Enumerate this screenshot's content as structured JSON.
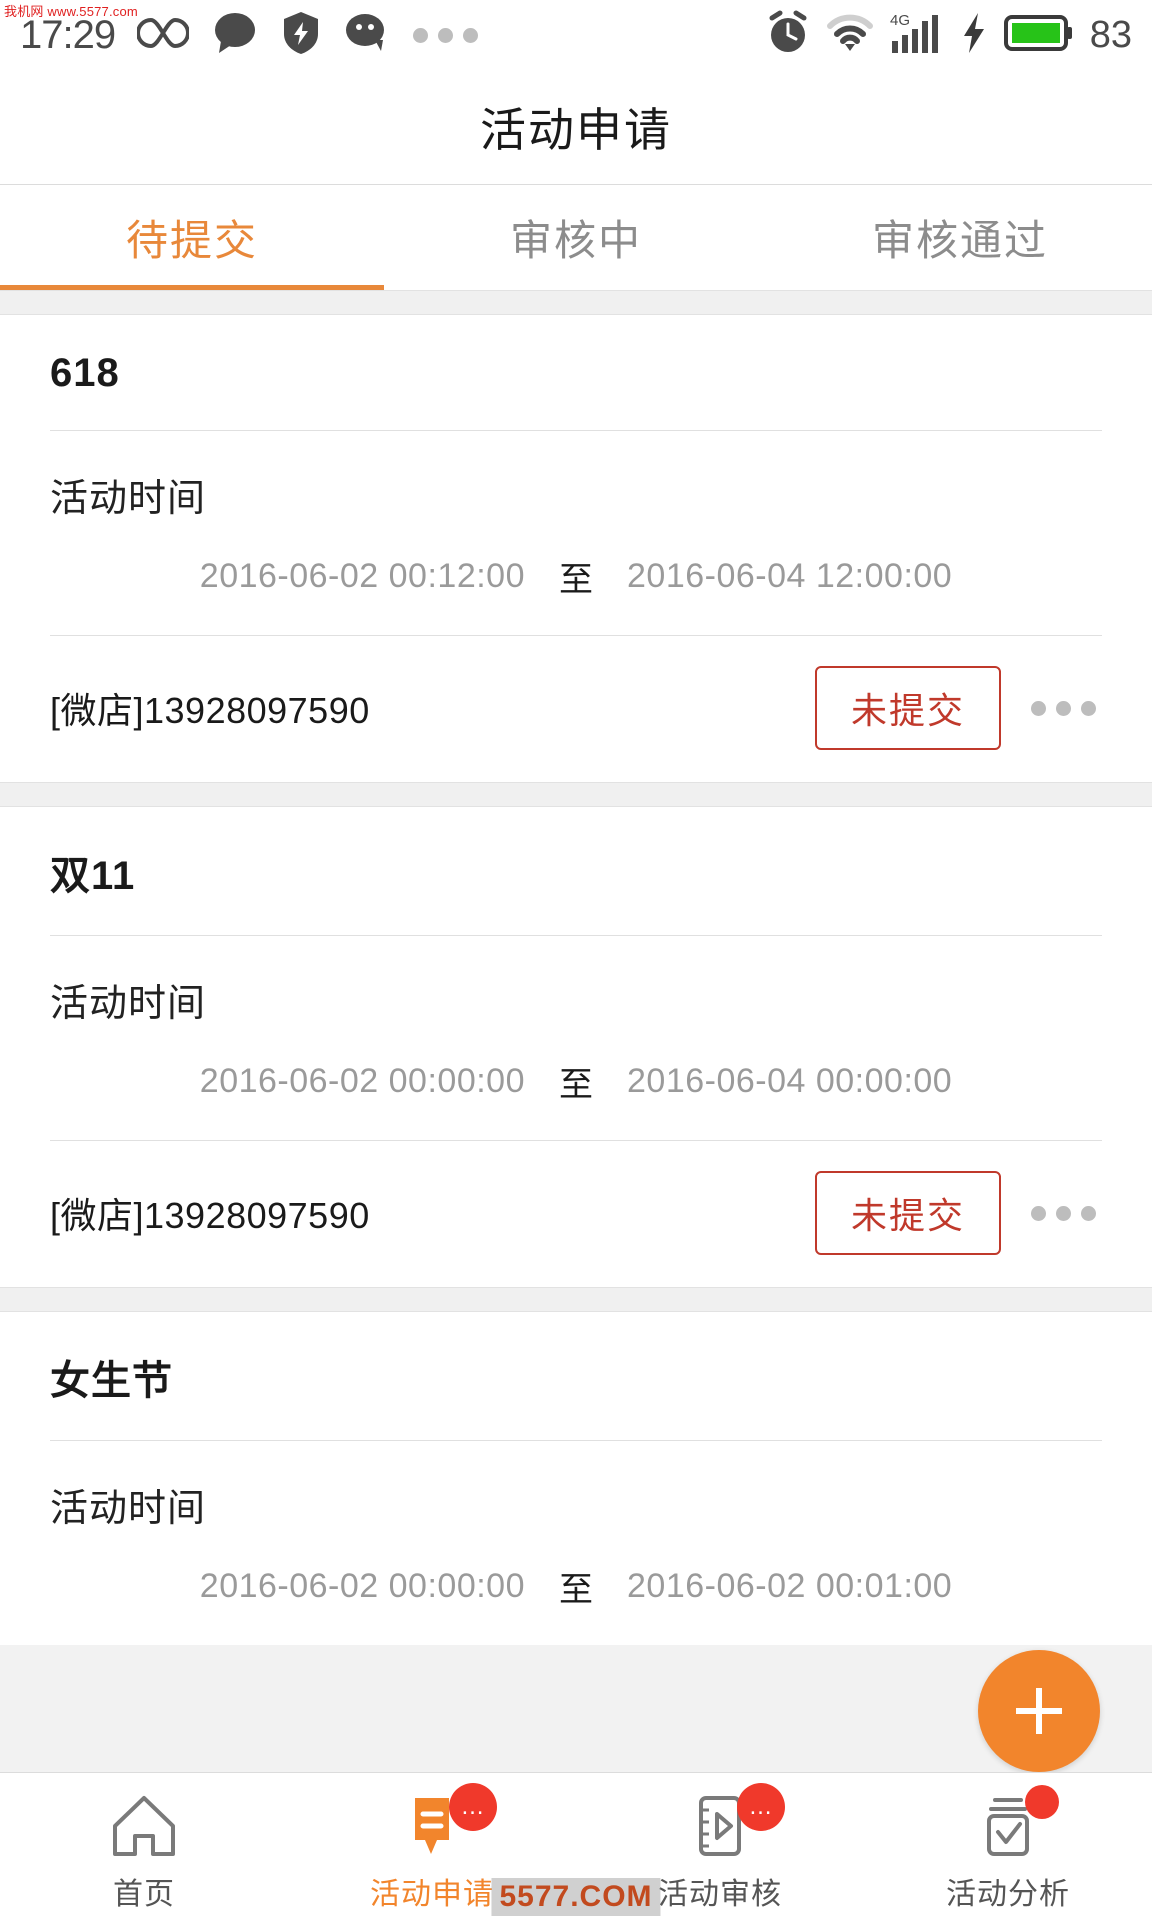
{
  "statusbar": {
    "time": "17:29",
    "battery_percent": "83",
    "icons_left": [
      "infinity-icon",
      "chat-bubble-icon",
      "shield-bolt-icon",
      "wechat-icon",
      "more-dots-icon"
    ],
    "icons_right": [
      "alarm-clock-icon",
      "wifi-icon",
      "signal-4g-icon",
      "charging-bolt-icon",
      "battery-icon"
    ],
    "network_label": "4G"
  },
  "watermarks": {
    "top": "我机网 www.5577.com",
    "bottom": "5577.COM"
  },
  "header": {
    "title": "活动申请"
  },
  "tabs": {
    "active_index": 0,
    "items": [
      {
        "label": "待提交"
      },
      {
        "label": "审核中"
      },
      {
        "label": "审核通过"
      }
    ]
  },
  "labels": {
    "time_label": "活动时间",
    "date_separator": "至"
  },
  "colors": {
    "accent": "#e8883a",
    "fab": "#f2852c",
    "status_red": "#c0392b",
    "badge_red": "#f0392b",
    "battery_green": "#27c318"
  },
  "cards": [
    {
      "title": "618",
      "time_label": "活动时间",
      "start": "2016-06-02 00:12:00",
      "separator": "至",
      "end": "2016-06-04 12:00:00",
      "shop": "[微店]13928097590",
      "status": "未提交",
      "more": "more-icon"
    },
    {
      "title": "双11",
      "time_label": "活动时间",
      "start": "2016-06-02 00:00:00",
      "separator": "至",
      "end": "2016-06-04 00:00:00",
      "shop": "[微店]13928097590",
      "status": "未提交",
      "more": "more-icon"
    },
    {
      "title": "女生节",
      "time_label": "活动时间",
      "start": "2016-06-02 00:00:00",
      "separator": "至",
      "end": "2016-06-02 00:01:00",
      "shop": "",
      "status": "",
      "more": "more-icon"
    }
  ],
  "fab": {
    "name": "add-activity-button",
    "icon": "plus-icon"
  },
  "bottomnav": {
    "active_index": 1,
    "items": [
      {
        "label": "首页",
        "icon": "home-icon",
        "badge": ""
      },
      {
        "label": "活动申请",
        "icon": "speech-bubble-icon",
        "badge": "…"
      },
      {
        "label": "活动审核",
        "icon": "video-review-icon",
        "badge": "…"
      },
      {
        "label": "活动分析",
        "icon": "analysis-check-icon",
        "badge": ""
      }
    ]
  }
}
